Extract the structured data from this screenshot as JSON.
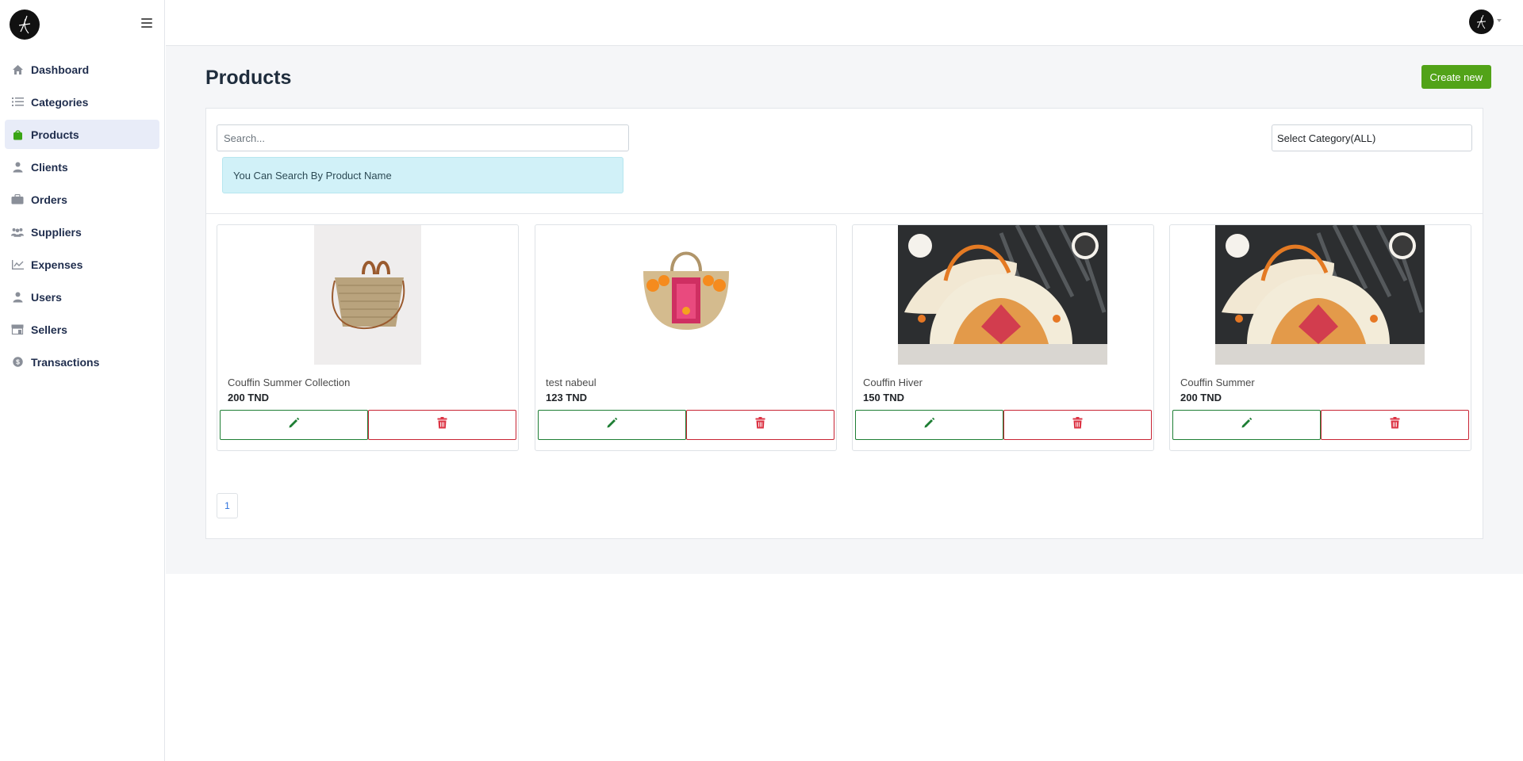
{
  "sidebar": {
    "logo": "logo-signature",
    "toggle_icon": "hamburger-icon",
    "items": [
      {
        "label": "Dashboard",
        "icon": "home-icon",
        "active": false
      },
      {
        "label": "Categories",
        "icon": "list-icon",
        "active": false
      },
      {
        "label": "Products",
        "icon": "shopping-bag-icon",
        "active": true
      },
      {
        "label": "Clients",
        "icon": "user-icon",
        "active": false
      },
      {
        "label": "Orders",
        "icon": "briefcase-icon",
        "active": false
      },
      {
        "label": "Suppliers",
        "icon": "users-icon",
        "active": false
      },
      {
        "label": "Expenses",
        "icon": "chart-line-icon",
        "active": false
      },
      {
        "label": "Users",
        "icon": "user-icon",
        "active": false
      },
      {
        "label": "Sellers",
        "icon": "store-icon",
        "active": false
      },
      {
        "label": "Transactions",
        "icon": "dollar-circle-icon",
        "active": false
      }
    ]
  },
  "header": {
    "avatar": "user-avatar"
  },
  "main": {
    "title": "Products",
    "create_label": "Create new",
    "search": {
      "placeholder": "Search..."
    },
    "hint": "You Can Search By Product Name",
    "category_select": "Select Category(ALL)",
    "products": [
      {
        "name": "Couffin Summer Collection",
        "price": "200 TND",
        "image": "straw-bag-brown-handles"
      },
      {
        "name": "test nabeul",
        "price": "123 TND",
        "image": "straw-basket-pink-pompoms"
      },
      {
        "name": "Couffin Hiver",
        "price": "150 TND",
        "image": "woven-bag-orange-pattern"
      },
      {
        "name": "Couffin Summer",
        "price": "200 TND",
        "image": "woven-bag-orange-pattern"
      }
    ],
    "pagination": [
      "1"
    ]
  },
  "colors": {
    "accent_green": "#52a318",
    "edit_green": "#1e7e34",
    "delete_red": "#dc3545",
    "hint_bg": "#d1f1f8",
    "active_nav": "#e8ecf8"
  }
}
